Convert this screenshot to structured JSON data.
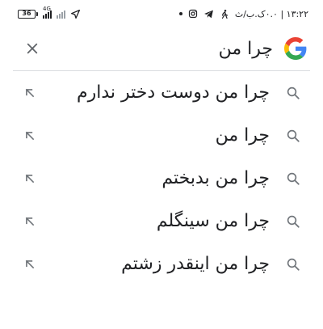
{
  "status_bar": {
    "battery_level": "36",
    "network_type": "4G",
    "time": "۱۳:۲۲ | ۰.۰ک.ب/ث",
    "icons": [
      "battery-icon",
      "signal-icon",
      "signal-icon-dim",
      "location-arrow-icon",
      "dot-icon",
      "instagram-icon",
      "telegram-icon",
      "walking-icon"
    ]
  },
  "search": {
    "query": "چرا من",
    "close_icon": "close-icon",
    "logo": "google-g-logo"
  },
  "suggestions": [
    {
      "text": "چرا من دوست دختر ندارم"
    },
    {
      "text": "چرا من"
    },
    {
      "text": "چرا من بدبختم"
    },
    {
      "text": "چرا من سینگلم"
    },
    {
      "text": "چرا من اینقدر زشتم"
    }
  ],
  "colors": {
    "google_blue": "#4285F4",
    "google_red": "#EA4335",
    "google_yellow": "#FBBC05",
    "google_green": "#34A853",
    "icon_gray": "#70757a",
    "divider": "#dadce0"
  }
}
